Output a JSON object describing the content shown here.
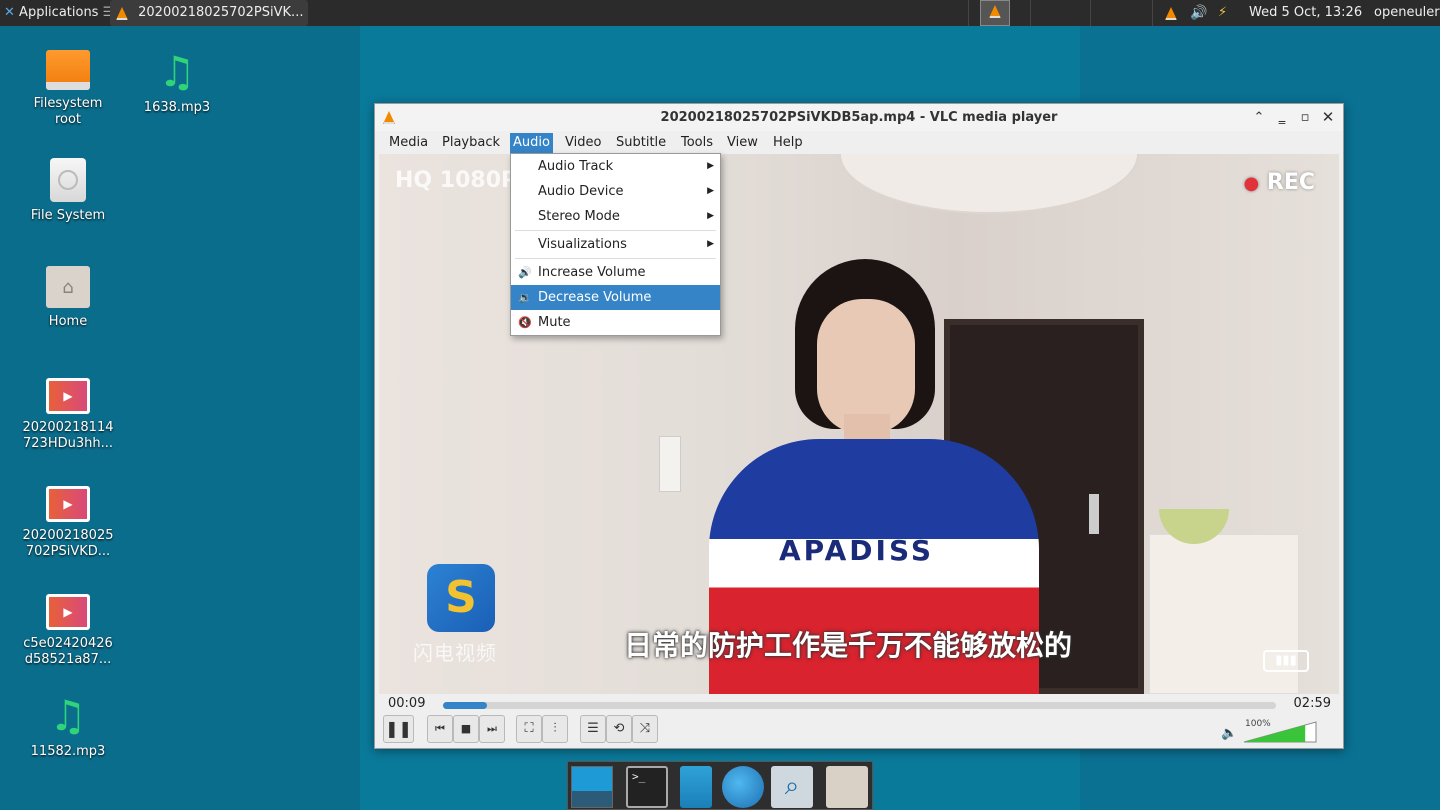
{
  "top_panel": {
    "applications_label": "Applications",
    "task_label": "20200218025702PSiVK...",
    "datetime": "Wed  5 Oct, 13:26",
    "user": "openeuler"
  },
  "desktop_icons": [
    {
      "label": "Filesystem\nroot"
    },
    {
      "label": "1638.mp3"
    },
    {
      "label": "File System"
    },
    {
      "label": "Home"
    },
    {
      "label": "20200218114\n723HDu3hh..."
    },
    {
      "label": "20200218025\n702PSiVKD..."
    },
    {
      "label": "c5e02420426\nd58521a87..."
    },
    {
      "label": "11582.mp3"
    }
  ],
  "vlc": {
    "title": "20200218025702PSiVKDB5ap.mp4 - VLC media player",
    "menu": [
      "Media",
      "Playback",
      "Audio",
      "Video",
      "Subtitle",
      "Tools",
      "View",
      "Help"
    ],
    "audio_menu": {
      "items": [
        {
          "label": "Audio Track",
          "submenu": true
        },
        {
          "label": "Audio Device",
          "submenu": true
        },
        {
          "label": "Stereo Mode",
          "submenu": true
        },
        {
          "label": "Visualizations",
          "submenu": true
        },
        {
          "label": "Increase Volume"
        },
        {
          "label": "Decrease Volume",
          "selected": true
        },
        {
          "label": "Mute"
        }
      ]
    },
    "video_overlay": {
      "top_left": "HQ 1080P",
      "top_right": "REC",
      "subtitle": "日常的防护工作是千万不能够放松的",
      "shirt_text": "APADISS",
      "logo_text": "闪电视频"
    },
    "time_current": "00:09",
    "time_total": "02:59",
    "progress": 0.053,
    "volume_label": "100%",
    "volume": 1.0
  },
  "colors": {
    "accent": "#3584c8",
    "panel": "#2b2b2b",
    "vlc_orange": "#f28a00"
  }
}
